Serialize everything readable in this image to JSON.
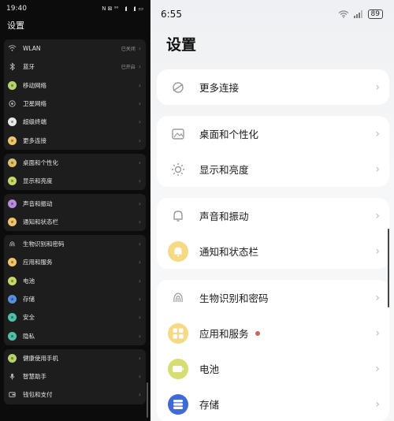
{
  "left": {
    "status": {
      "time": "19:40",
      "indicators": "N ⊠ ⁹⁰"
    },
    "title": "设置",
    "groups": [
      {
        "items": [
          {
            "label": "WLAN",
            "value": "已关闭",
            "icon": "wifi-icon",
            "color": ""
          },
          {
            "label": "蓝牙",
            "value": "已开启",
            "icon": "bluetooth-icon",
            "color": ""
          },
          {
            "label": "移动网络",
            "value": "",
            "icon": "mobile-network-icon",
            "color": "#b5d36a"
          },
          {
            "label": "卫星网络",
            "value": "",
            "icon": "satellite-icon",
            "color": ""
          },
          {
            "label": "超级终端",
            "value": "",
            "icon": "super-device-icon",
            "color": "#e8e8e8"
          },
          {
            "label": "更多连接",
            "value": "",
            "icon": "more-connections-icon",
            "color": "#f2c46a"
          }
        ]
      },
      {
        "items": [
          {
            "label": "桌面和个性化",
            "value": "",
            "icon": "desktop-icon",
            "color": "#d9c26a"
          },
          {
            "label": "显示和亮度",
            "value": "",
            "icon": "display-icon",
            "color": "#c9d66a"
          }
        ]
      },
      {
        "items": [
          {
            "label": "声音和振动",
            "value": "",
            "icon": "sound-icon",
            "color": "#b88ae0"
          },
          {
            "label": "通知和状态栏",
            "value": "",
            "icon": "notification-icon",
            "color": "#f2c46a"
          }
        ]
      },
      {
        "items": [
          {
            "label": "生物识别和密码",
            "value": "",
            "icon": "fingerprint-icon",
            "color": ""
          },
          {
            "label": "应用和服务",
            "value": "",
            "icon": "apps-icon",
            "color": "#f2c46a"
          },
          {
            "label": "电池",
            "value": "",
            "icon": "battery-icon",
            "color": "#c9d66a"
          },
          {
            "label": "存储",
            "value": "",
            "icon": "storage-icon",
            "color": "#5a8ee0"
          },
          {
            "label": "安全",
            "value": "",
            "icon": "security-icon",
            "color": "#4ec0a8"
          },
          {
            "label": "隐私",
            "value": "",
            "icon": "privacy-icon",
            "color": "#4ec0a8"
          }
        ]
      },
      {
        "items": [
          {
            "label": "健康使用手机",
            "value": "",
            "icon": "health-icon",
            "color": "#b5d36a"
          },
          {
            "label": "智慧助手",
            "value": "",
            "icon": "assistant-icon",
            "color": ""
          },
          {
            "label": "钱包和支付",
            "value": "",
            "icon": "wallet-icon",
            "color": ""
          }
        ]
      }
    ]
  },
  "right": {
    "status": {
      "time": "6:55",
      "battery": "89"
    },
    "title": "设置",
    "cards": [
      {
        "items": [
          {
            "label": "更多连接",
            "icon": "more-connections-icon",
            "color": "",
            "dot": false
          }
        ]
      },
      {
        "items": [
          {
            "label": "桌面和个性化",
            "icon": "desktop-icon",
            "color": "",
            "dot": false
          },
          {
            "label": "显示和亮度",
            "icon": "display-icon",
            "color": "",
            "dot": false
          }
        ]
      },
      {
        "items": [
          {
            "label": "声音和振动",
            "icon": "sound-icon",
            "color": "",
            "dot": false
          },
          {
            "label": "通知和状态栏",
            "icon": "notification-icon",
            "color": "#f6d985",
            "dot": false
          }
        ]
      },
      {
        "items": [
          {
            "label": "生物识别和密码",
            "icon": "fingerprint-icon",
            "color": "",
            "dot": false
          },
          {
            "label": "应用和服务",
            "icon": "apps-icon",
            "color": "#f6d985",
            "dot": true
          },
          {
            "label": "电池",
            "icon": "battery-icon",
            "color": "#d4de72",
            "dot": false
          },
          {
            "label": "存储",
            "icon": "storage-icon",
            "color": "#3f6ad8",
            "dot": false
          }
        ]
      }
    ]
  }
}
